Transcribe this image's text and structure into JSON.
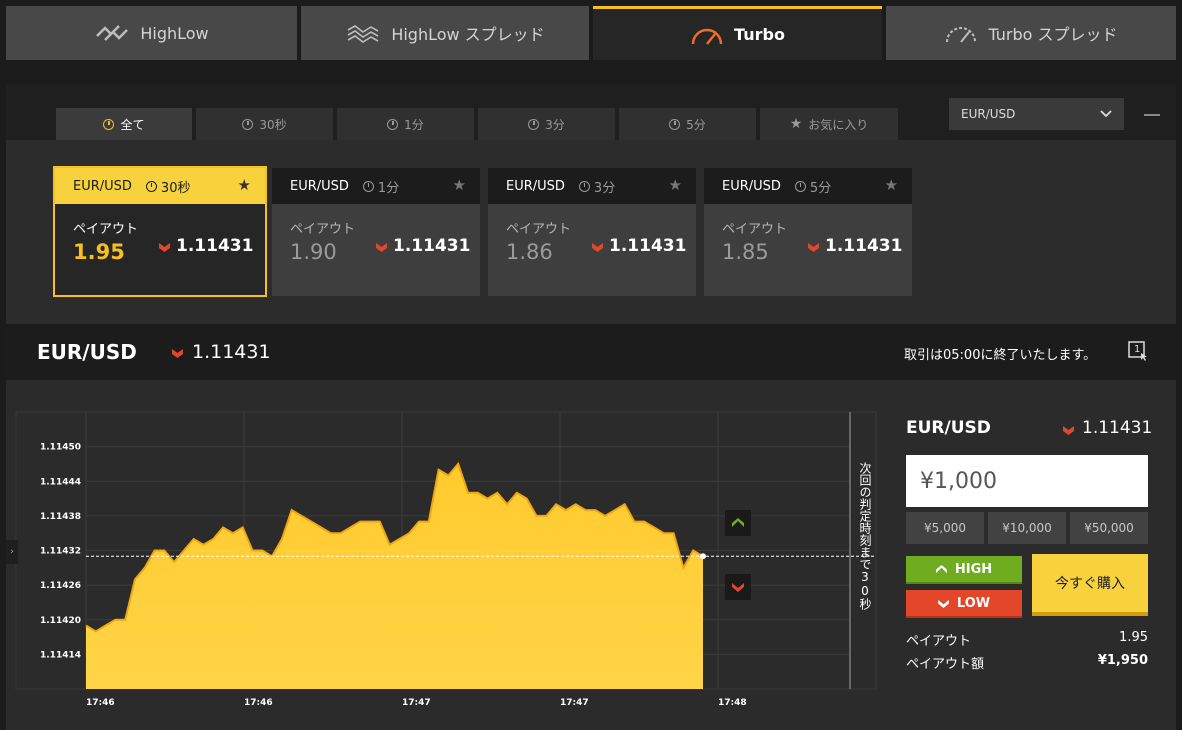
{
  "top_tabs": [
    {
      "label": "HighLow",
      "icon": "highlow-icon"
    },
    {
      "label": "HighLow スプレッド",
      "icon": "highlow-spread-icon"
    },
    {
      "label": "Turbo",
      "icon": "speedometer-icon",
      "active": true
    },
    {
      "label": "Turbo スプレッド",
      "icon": "speedometer-outline-icon"
    }
  ],
  "filter_tabs": [
    {
      "label": "全て",
      "active": true
    },
    {
      "label": "30秒"
    },
    {
      "label": "1分"
    },
    {
      "label": "3分"
    },
    {
      "label": "5分"
    },
    {
      "label": "お気に入り"
    }
  ],
  "asset_select": {
    "value": "EUR/USD"
  },
  "cards": [
    {
      "pair": "EUR/USD",
      "duration": "30秒",
      "payout_label": "ペイアウト",
      "payout": "1.95",
      "price": "1.11431",
      "selected": true
    },
    {
      "pair": "EUR/USD",
      "duration": "1分",
      "payout_label": "ペイアウト",
      "payout": "1.90",
      "price": "1.11431"
    },
    {
      "pair": "EUR/USD",
      "duration": "3分",
      "payout_label": "ペイアウト",
      "payout": "1.86",
      "price": "1.11431"
    },
    {
      "pair": "EUR/USD",
      "duration": "5分",
      "payout_label": "ペイアウト",
      "payout": "1.85",
      "price": "1.11431"
    }
  ],
  "info": {
    "pair": "EUR/USD",
    "price": "1.11431",
    "message": "取引は05:00に終了いたします。",
    "window_button": "1"
  },
  "chart_data": {
    "type": "area",
    "y_ticks": [
      "1.11450",
      "1.11444",
      "1.11438",
      "1.11432",
      "1.11426",
      "1.11420",
      "1.11414"
    ],
    "ylim": [
      1.11408,
      1.11456
    ],
    "x_ticks": [
      "17:46",
      "17:46",
      "17:47",
      "17:47",
      "17:48"
    ],
    "current_price": 1.11431,
    "countdown_text": "次回の判定時刻まで30秒",
    "series": [
      {
        "values": [
          1.11419,
          1.11418,
          1.11419,
          1.1142,
          1.1142,
          1.11427,
          1.11429,
          1.11432,
          1.11432,
          1.1143,
          1.11432,
          1.11434,
          1.11433,
          1.11434,
          1.11436,
          1.11435,
          1.11436,
          1.11432,
          1.11432,
          1.11431,
          1.11434,
          1.11439,
          1.11438,
          1.11437,
          1.11436,
          1.11435,
          1.11435,
          1.11436,
          1.11437,
          1.11437,
          1.11437,
          1.11433,
          1.11434,
          1.11435,
          1.11437,
          1.11437,
          1.11446,
          1.11445,
          1.11447,
          1.11442,
          1.11442,
          1.11441,
          1.11442,
          1.1144,
          1.11442,
          1.11441,
          1.11438,
          1.11438,
          1.1144,
          1.11439,
          1.1144,
          1.11439,
          1.11439,
          1.11438,
          1.11439,
          1.1144,
          1.11437,
          1.11437,
          1.11436,
          1.11435,
          1.11435,
          1.11429,
          1.11432,
          1.11431
        ]
      }
    ]
  },
  "trade": {
    "pair": "EUR/USD",
    "price": "1.11431",
    "amount": "¥1,000",
    "quick_amounts": [
      "¥5,000",
      "¥10,000",
      "¥50,000"
    ],
    "high_label": "HIGH",
    "low_label": "LOW",
    "buy_label": "今すぐ購入",
    "payout_label": "ペイアウト",
    "payout_value": "1.95",
    "payout_amount_label": "ペイアウト額",
    "payout_amount_value": "¥1,950"
  },
  "colors": {
    "accent": "#f7c01f",
    "high": "#6fac1f",
    "low": "#e4462a",
    "down_arrow": "#e4462a"
  }
}
